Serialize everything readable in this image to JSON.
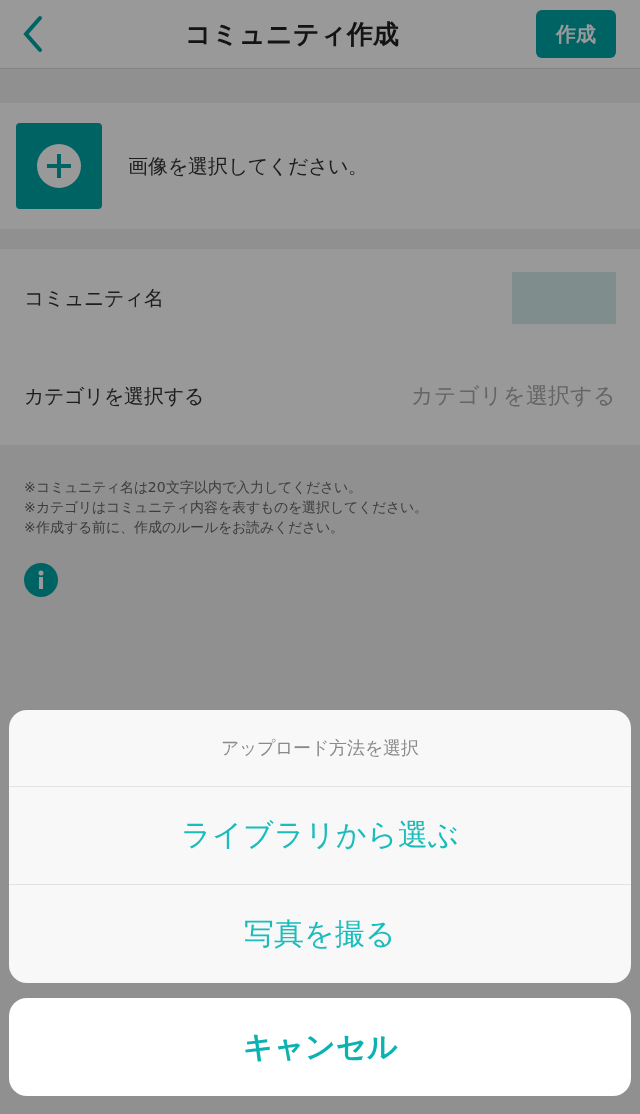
{
  "header": {
    "title": "コミュニティ作成",
    "action": "作成"
  },
  "image_picker": {
    "label": "画像を選択してください。"
  },
  "form": {
    "rows": [
      {
        "kind": "input",
        "label": "コミュニティ名"
      },
      {
        "kind": "select",
        "label": "カテゴリを選択する",
        "placeholder": "カテゴリを選択する"
      }
    ]
  },
  "notes": [
    "※コミュニティ名は20文字以内で入力してください。",
    "※カテゴリはコミュニティ内容を表すものを選択してください。",
    "※作成する前に、作成のルールをお読みください。"
  ],
  "action_sheet": {
    "title": "アップロード方法を選択",
    "options": [
      "ライブラリから選ぶ",
      "写真を撮る"
    ],
    "cancel": "キャンセル"
  }
}
